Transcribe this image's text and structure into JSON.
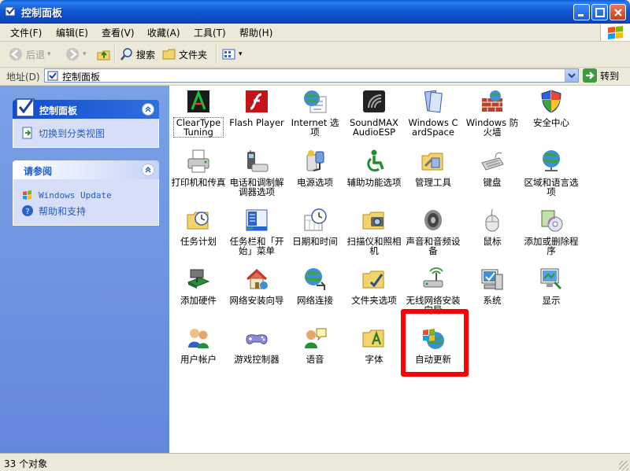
{
  "window": {
    "title": "控制面板",
    "controls": {
      "minimize": "minimize",
      "maximize": "maximize",
      "close": "close"
    }
  },
  "menu": [
    {
      "label": "文件(F)"
    },
    {
      "label": "编辑(E)"
    },
    {
      "label": "查看(V)"
    },
    {
      "label": "收藏(A)"
    },
    {
      "label": "工具(T)"
    },
    {
      "label": "帮助(H)"
    }
  ],
  "toolbar": {
    "back": "后退",
    "search": "搜索",
    "folders": "文件夹"
  },
  "address": {
    "label": "地址(D)",
    "value": "控制面板",
    "go": "转到"
  },
  "sidebar": {
    "panel1": {
      "title": "控制面板",
      "link": "切换到分类视图"
    },
    "panel2": {
      "title": "请参阅",
      "links": [
        "Windows Update",
        "帮助和支持"
      ]
    }
  },
  "items": [
    {
      "label": "ClearType Tuning",
      "icon": "cleartype-icon"
    },
    {
      "label": "Flash Player",
      "icon": "flash-icon"
    },
    {
      "label": "Internet 选项",
      "icon": "internet-options-icon"
    },
    {
      "label": "SoundMAX AudioESP",
      "icon": "soundmax-icon"
    },
    {
      "label": "Windows CardSpace",
      "icon": "cardspace-icon"
    },
    {
      "label": "Windows 防火墙",
      "icon": "firewall-icon"
    },
    {
      "label": "安全中心",
      "icon": "security-center-icon"
    },
    {
      "label": "打印机和传真",
      "icon": "printer-icon"
    },
    {
      "label": "电话和调制解调器选项",
      "icon": "phone-modem-icon"
    },
    {
      "label": "电源选项",
      "icon": "power-icon"
    },
    {
      "label": "辅助功能选项",
      "icon": "accessibility-icon"
    },
    {
      "label": "管理工具",
      "icon": "admin-tools-icon"
    },
    {
      "label": "键盘",
      "icon": "keyboard-icon"
    },
    {
      "label": "区域和语言选项",
      "icon": "region-language-icon"
    },
    {
      "label": "任务计划",
      "icon": "scheduled-tasks-icon"
    },
    {
      "label": "任务栏和「开始」菜单",
      "icon": "taskbar-icon"
    },
    {
      "label": "日期和时间",
      "icon": "date-time-icon"
    },
    {
      "label": "扫描仪和照相机",
      "icon": "scanner-camera-icon"
    },
    {
      "label": "声音和音频设备",
      "icon": "sound-icon"
    },
    {
      "label": "鼠标",
      "icon": "mouse-icon"
    },
    {
      "label": "添加或删除程序",
      "icon": "add-remove-programs-icon"
    },
    {
      "label": "添加硬件",
      "icon": "add-hardware-icon"
    },
    {
      "label": "网络安装向导",
      "icon": "network-setup-icon"
    },
    {
      "label": "网络连接",
      "icon": "network-connections-icon"
    },
    {
      "label": "文件夹选项",
      "icon": "folder-options-icon"
    },
    {
      "label": "无线网络安装向导",
      "icon": "wireless-icon"
    },
    {
      "label": "系统",
      "icon": "system-icon"
    },
    {
      "label": "显示",
      "icon": "display-icon"
    },
    {
      "label": "用户帐户",
      "icon": "user-accounts-icon"
    },
    {
      "label": "游戏控制器",
      "icon": "game-controller-icon"
    },
    {
      "label": "语音",
      "icon": "speech-icon"
    },
    {
      "label": "字体",
      "icon": "fonts-icon"
    },
    {
      "label": "自动更新",
      "icon": "automatic-updates-icon"
    }
  ],
  "status": {
    "text": "33 个对象"
  },
  "colors": {
    "highlight": "#ff0000",
    "titlebar": "#0a4cc4",
    "sidebar": "#6f95e0"
  }
}
